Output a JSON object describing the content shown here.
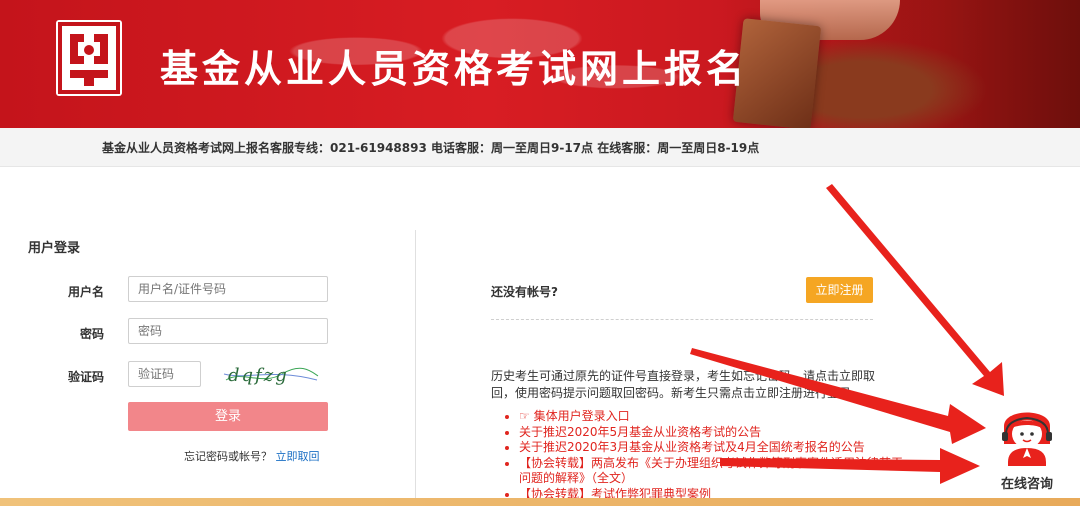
{
  "header": {
    "title": "基金从业人员资格考试网上报名",
    "logo_icon": "fund-association-logo",
    "hotline": "基金从业人员资格考试网上报名客服专线：021-61948893 电话客服：周一至周日9-17点 在线客服：周一至周日8-19点"
  },
  "login": {
    "title": "用户登录",
    "username_label": "用户名",
    "username_placeholder": "用户名/证件号码",
    "password_label": "密码",
    "password_placeholder": "密码",
    "captcha_label": "验证码",
    "captcha_placeholder": "验证码",
    "captcha_text": "dqfzg",
    "login_button": "登录",
    "forgot_text": "忘记密码或帐号？",
    "forgot_link": "立即取回"
  },
  "register": {
    "question": "还没有帐号?",
    "button": "立即注册",
    "history_text": "历史考生可通过原先的证件号直接登录，考生如忘记密码，请点击立即取回，使用密码提示问题取回密码。新考生只需点击立即注册进行登录。",
    "notices": [
      "☞ 集体用户登录入口",
      "关于推迟2020年5月基金从业资格考试的公告",
      "关于推迟2020年3月基金从业资格考试及4月全国统考报名的公告",
      "【协会转载】两高发布《关于办理组织考试作弊等刑事案件适用法律若干问题的解释》（全文）",
      "【协会转载】考试作弊犯罪典型案例"
    ]
  },
  "consult": {
    "label": "在线咨询",
    "icon": "customer-service-agent-icon"
  },
  "colors": {
    "banner_red": "#d81d23",
    "login_button": "#f2868a",
    "register_button": "#f5a623",
    "notice_red": "#e0251f",
    "link_blue": "#1a6fc4",
    "arrow_red": "#e8221c"
  }
}
